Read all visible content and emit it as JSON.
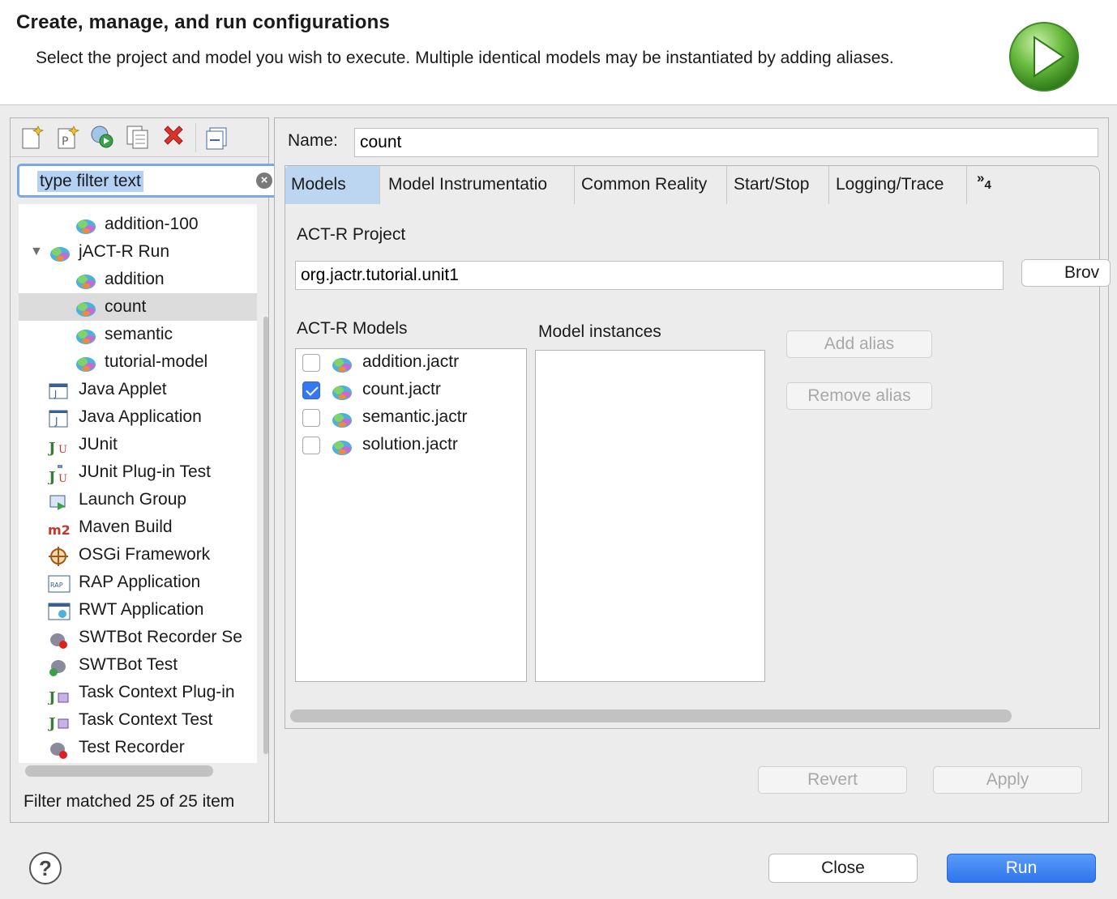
{
  "header": {
    "title": "Create, manage, and run configurations",
    "description": "Select the project and model you wish to execute. Multiple identical models may be instantiated by adding aliases."
  },
  "left": {
    "toolbar": [
      {
        "name": "new-configuration-icon"
      },
      {
        "name": "new-prototype-icon"
      },
      {
        "name": "export-configuration-icon"
      },
      {
        "name": "duplicate-configuration-icon"
      },
      {
        "name": "delete-configuration-icon"
      },
      {
        "name": "collapse-all-icon"
      }
    ],
    "filter": {
      "placeholder": "type filter text",
      "value": "type filter text"
    },
    "tree": [
      {
        "label": "addition-100",
        "icon": "jactr-model-icon",
        "indent": 2
      },
      {
        "label": "jACT-R Run",
        "icon": "jactr-run-icon",
        "indent": 1,
        "expanded": true
      },
      {
        "label": "addition",
        "icon": "jactr-model-icon",
        "indent": 2
      },
      {
        "label": "count",
        "icon": "jactr-model-icon",
        "indent": 2,
        "selected": true
      },
      {
        "label": "semantic",
        "icon": "jactr-model-icon",
        "indent": 2
      },
      {
        "label": "tutorial-model",
        "icon": "jactr-model-icon",
        "indent": 2
      },
      {
        "label": "Java Applet",
        "icon": "java-applet-icon",
        "indent": 1
      },
      {
        "label": "Java Application",
        "icon": "java-application-icon",
        "indent": 1
      },
      {
        "label": "JUnit",
        "icon": "junit-icon",
        "indent": 1
      },
      {
        "label": "JUnit Plug-in Test",
        "icon": "junit-plugin-icon",
        "indent": 1
      },
      {
        "label": "Launch Group",
        "icon": "launch-group-icon",
        "indent": 1
      },
      {
        "label": "Maven Build",
        "icon": "maven-icon",
        "indent": 1
      },
      {
        "label": "OSGi Framework",
        "icon": "osgi-icon",
        "indent": 1
      },
      {
        "label": "RAP Application",
        "icon": "rap-icon",
        "indent": 1
      },
      {
        "label": "RWT Application",
        "icon": "rwt-icon",
        "indent": 1
      },
      {
        "label": "SWTBot Recorder Se",
        "icon": "swtbot-recorder-icon",
        "indent": 1
      },
      {
        "label": "SWTBot Test",
        "icon": "swtbot-test-icon",
        "indent": 1
      },
      {
        "label": "Task Context Plug-in",
        "icon": "task-context-plugin-icon",
        "indent": 1
      },
      {
        "label": "Task Context Test",
        "icon": "task-context-test-icon",
        "indent": 1
      },
      {
        "label": "Test Recorder",
        "icon": "test-recorder-icon",
        "indent": 1
      }
    ],
    "status": "Filter matched 25 of 25 item"
  },
  "right": {
    "name_label": "Name:",
    "name_value": "count",
    "tabs": [
      {
        "label": "Models",
        "active": true
      },
      {
        "label": "Model Instrumentatio"
      },
      {
        "label": "Common Reality"
      },
      {
        "label": "Start/Stop"
      },
      {
        "label": "Logging/Trace"
      }
    ],
    "tab_overflow": {
      "symbol": "»",
      "count": "4"
    },
    "project_label": "ACT-R Project",
    "project_value": "org.jactr.tutorial.unit1",
    "browse_label": "Brov",
    "models_label": "ACT-R Models",
    "instances_label": "Model instances",
    "models": [
      {
        "label": "addition.jactr",
        "checked": false
      },
      {
        "label": "count.jactr",
        "checked": true
      },
      {
        "label": "semantic.jactr",
        "checked": false
      },
      {
        "label": "solution.jactr",
        "checked": false
      }
    ],
    "add_alias": "Add alias",
    "remove_alias": "Remove alias",
    "revert": "Revert",
    "apply": "Apply"
  },
  "footer": {
    "help": "?",
    "close": "Close",
    "run": "Run"
  },
  "colors": {
    "primary": "#2f74ec",
    "selection": "#dcdcdc",
    "tab_active": "#bcd6f2"
  }
}
